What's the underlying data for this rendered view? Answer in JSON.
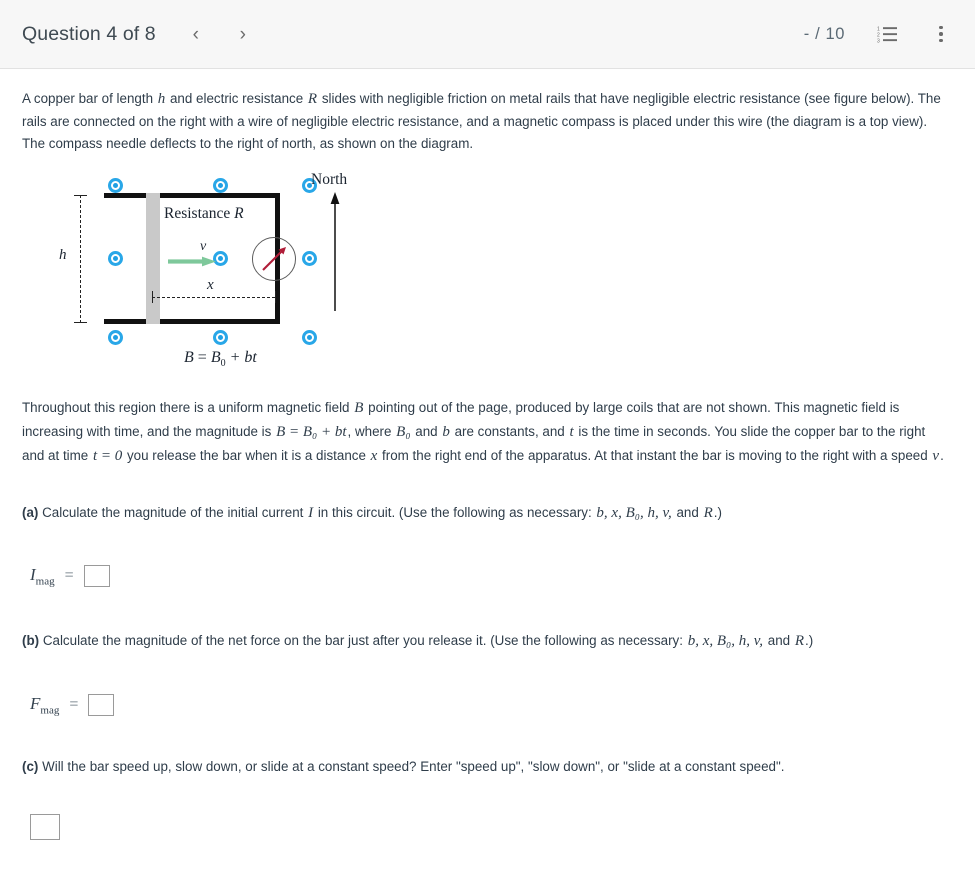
{
  "header": {
    "question_title": "Question 4 of 8",
    "prev_icon": "‹",
    "next_icon": "›",
    "score": "- / 10",
    "list_icon_name": "numbered-list-icon",
    "menu_icon_name": "vertical-dots-icon"
  },
  "intro": {
    "line": "A copper bar of length h and electric resistance R slides with negligible friction on metal rails that have negligible electric resistance (see figure below). The rails are connected on the right with a wire of negligible electric resistance, and a magnetic compass is placed under this wire (the diagram is a top view). The compass needle deflects to the right of north, as shown on the diagram.",
    "seg1": "A copper bar of length ",
    "sym_h": "h",
    "seg2": " and electric resistance ",
    "sym_R": "R",
    "seg3": " slides with negligible friction on metal rails that have negligible electric resistance (see figure below). The rails are connected on the right with a wire of negligible electric resistance, and a magnetic compass is placed under this wire (the diagram is a top view). The compass needle deflects to the right of north, as shown on the diagram."
  },
  "figure": {
    "resistance_label": "Resistance R",
    "resistance_word": "Resistance",
    "resistance_symbol": "R",
    "velocity_label": "v",
    "height_label": "h",
    "distance_label": "x",
    "north_label": "North",
    "field_equation": "B = B₀ + bt",
    "field_eq_lhs": "B",
    "field_eq_rhs": "B",
    "field_eq_sub": "0",
    "field_eq_tail": "+ bt",
    "dot_color": "#29a7e8",
    "bar_color": "#c9c9c9",
    "rail_color": "#111111",
    "velocity_arrow_color": "#7ec89b",
    "needle_color": "#b01d38",
    "field_dot_count": 9
  },
  "body": {
    "paragraph2_seg1": "Throughout this region there is a uniform magnetic field ",
    "paragraph2_B": "B",
    "paragraph2_seg2": " pointing out of the page, produced by large coils that are not shown. This magnetic field is increasing with time, and the magnitude is ",
    "paragraph2_eq": "B = B₀ + bt",
    "paragraph2_seg3": ", where ",
    "paragraph2_B0": "B₀",
    "paragraph2_seg4": " and ",
    "paragraph2_b": "b",
    "paragraph2_seg5": " are constants, and ",
    "paragraph2_t": "t",
    "paragraph2_seg6": " is the time in seconds. You slide the copper bar to the right and at time ",
    "paragraph2_t0": "t = 0",
    "paragraph2_seg7": " you release the bar when it is a distance ",
    "paragraph2_x": "x",
    "paragraph2_seg8": " from the right end of the apparatus. At that instant the bar is moving to the right with a speed ",
    "paragraph2_v": "v",
    "paragraph2_seg9": "."
  },
  "parts": {
    "a": {
      "marker": "(a)",
      "text_seg1": " Calculate the magnitude of the initial current ",
      "symbol_I": "I",
      "text_seg2": " in this circuit. (Use the following as necessary: ",
      "vars": "b,  x,  B₀,  h,  v,",
      "text_seg3": " and ",
      "var_R": "R",
      "text_seg4": ".)",
      "answer_label": "I",
      "answer_sub": "mag",
      "equals": "=",
      "answer_value": ""
    },
    "b": {
      "marker": "(b)",
      "text_seg1": " Calculate the magnitude of the net force on the bar just after you release it. (Use the following as necessary: ",
      "vars": "b,  x,  B₀,  h,  v,",
      "text_seg2": " and ",
      "var_R": "R",
      "text_seg3": ".)",
      "answer_label": "F",
      "answer_sub": "mag",
      "equals": "=",
      "answer_value": ""
    },
    "c": {
      "marker": "(c)",
      "text": " Will the bar speed up, slow down, or slide at a constant speed? Enter \"speed up\", \"slow down\", or \"slide at a constant speed\".",
      "answer_value": ""
    }
  }
}
